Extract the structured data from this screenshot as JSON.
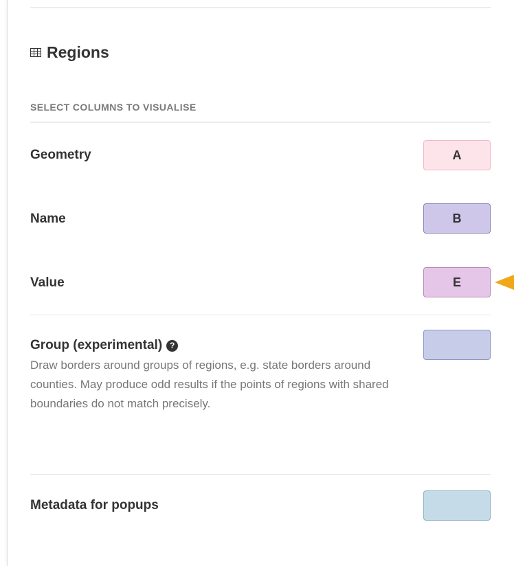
{
  "section": {
    "title": "Regions",
    "icon": "table-icon"
  },
  "subheader": "SELECT COLUMNS TO VISUALISE",
  "rows": [
    {
      "label": "Geometry",
      "column": "A",
      "bg": "#fde3ea",
      "border": "#efb9c8"
    },
    {
      "label": "Name",
      "column": "B",
      "bg": "#cfc7ea",
      "border": "#8e85b6"
    },
    {
      "label": "Value",
      "column": "E",
      "bg": "#e5c6e8",
      "border": "#b68ab6"
    },
    {
      "label": "Group (experimental)",
      "column": "",
      "help_icon": "?",
      "description": "Draw borders around groups of regions, e.g. state borders around counties. May produce odd results if the points of regions with shared boundaries do not match precisely.",
      "bg": "#c7cde9",
      "border": "#8d97c4"
    },
    {
      "label": "Metadata for popups",
      "column": "",
      "bg": "#c5dbe8",
      "border": "#8eb4c8"
    }
  ],
  "colors": {
    "pointer": "#f0a81a"
  }
}
